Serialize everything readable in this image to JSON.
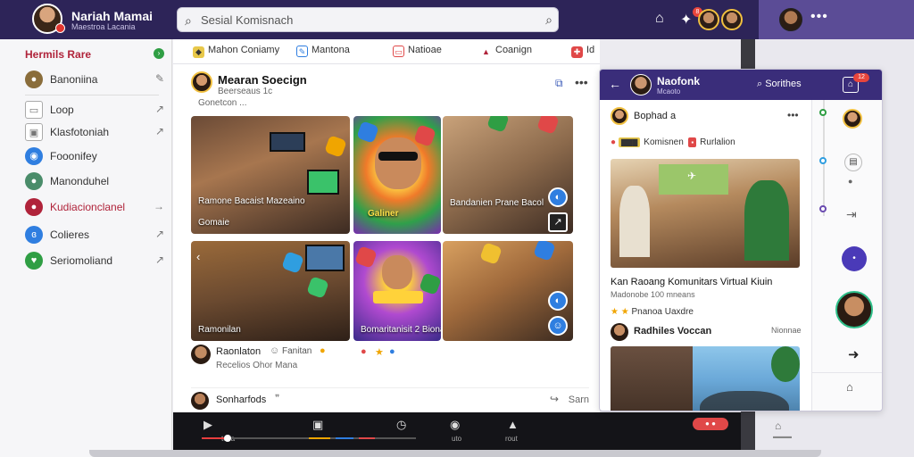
{
  "topbar": {
    "profile_name": "Nariah Mamai",
    "profile_sub": "Maestroa Lacania",
    "search_placeholder": "Sesial Komisnach",
    "notif_count": "8"
  },
  "sidebar": {
    "title": "Hermils Rare",
    "items": [
      {
        "label": "Banoniina",
        "icon": "avatar-icon",
        "color": "#8a6d3b"
      },
      {
        "label": "Loop",
        "icon": "inbox-icon",
        "color": "#777777"
      },
      {
        "label": "Klasfotoniah",
        "icon": "lock-icon",
        "color": "#777777"
      },
      {
        "label": "Fooonifey",
        "icon": "compass-icon",
        "color": "#2f7ee0"
      },
      {
        "label": "Manonduhel",
        "icon": "avatar-icon",
        "color": "#4a8c6a"
      },
      {
        "label": "Kudiacionclanel",
        "icon": "avatar-icon",
        "color": "#b0233a"
      },
      {
        "label": "Colieres",
        "icon": "bag-icon",
        "color": "#2f7ee0"
      },
      {
        "label": "Seriomoliand",
        "icon": "leaf-icon",
        "color": "#2f9e44"
      }
    ]
  },
  "feed": {
    "tabs": [
      {
        "label": "Mahon Coniamy",
        "icon_color": "#e8c84a"
      },
      {
        "label": "Mantona",
        "icon_color": "#2f7ee0"
      },
      {
        "label": "Natioae",
        "icon_color": "#e04848"
      },
      {
        "label": "Coanign",
        "icon_color": "#b0233a"
      },
      {
        "label": "Id",
        "icon_color": "#e04848"
      }
    ],
    "post": {
      "title": "Mearan Soecign",
      "meta": "Beerseaus 1c",
      "meta2": "Gonetcon ..."
    },
    "tiles": [
      {
        "caption": "Ramone Bacaist Mazeaino",
        "caption2": "Gomaie"
      },
      {
        "caption": "Galiner"
      },
      {
        "caption": "Bandanien Prane Bacol"
      },
      {
        "caption": ""
      },
      {
        "caption": "Ramonilan"
      },
      {
        "caption": "Bomaritanisit 2 Bionan 3"
      }
    ],
    "comment": {
      "name": "Raonlaton",
      "reaction": "Fanitan",
      "text": "Recelios Ohor Mana"
    },
    "footer": {
      "name": "Sonharfods",
      "share": "Sarn"
    }
  },
  "player": {
    "labels": [
      "tosa",
      "",
      "",
      "uto",
      "rout",
      ""
    ],
    "progress": 0.12
  },
  "panel": {
    "title": "Naofonk",
    "subtitle": "Mcaoto",
    "search_label": "Sorithes",
    "badge": "12",
    "author": "Bophad a",
    "tag1": "Komisnen",
    "tag2": "Rurlalion",
    "headline": "Kan Raoang Komunitars Virtual Kiuin",
    "sub": "Madonobe 100 mneans",
    "stars_label": "Pnanoa Uaxdre",
    "author2": "Radhiles Voccan",
    "badge2": "Nionnae"
  }
}
